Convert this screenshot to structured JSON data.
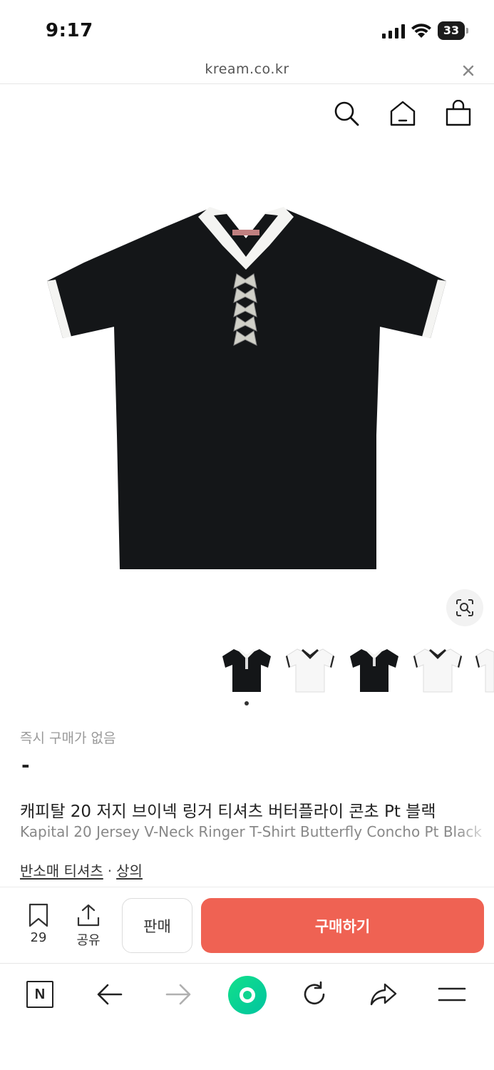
{
  "status_bar": {
    "time": "9:17",
    "battery": "33"
  },
  "url_bar": {
    "domain": "kream.co.kr"
  },
  "header": {
    "icons": [
      "search-icon",
      "home-icon",
      "shopping-bag-icon"
    ]
  },
  "product": {
    "price_label": "즉시 구매가 없음",
    "price_value": "-",
    "title_ko": "캐피탈 20 저지 브이넥 링거 티셔츠 버터플라이 콘초 Pt 블랙",
    "title_en": "Kapital 20 Jersey V-Neck Ringer T-Shirt Butterfly Concho Pt Black",
    "category_primary": "반소매 티셔츠",
    "category_separator": "·",
    "category_secondary": "상의"
  },
  "thumbnails": [
    {
      "variant": "black-white-trim",
      "selected": true
    },
    {
      "variant": "white-black-trim",
      "selected": false
    },
    {
      "variant": "black-white-trim",
      "selected": false
    },
    {
      "variant": "white-black-trim",
      "selected": false
    },
    {
      "variant": "white-partial",
      "selected": false
    }
  ],
  "actions": {
    "wish_count": "29",
    "share_label": "공유",
    "sell_label": "판매",
    "buy_label": "구매하기"
  },
  "browser_toolbar": {
    "naver_label": "N",
    "icons": [
      "naver-icon",
      "back-arrow-icon",
      "forward-arrow-icon",
      "green-dot-button",
      "refresh-icon",
      "share-arrow-icon",
      "menu-icon"
    ]
  },
  "colors": {
    "buy_button": "#ef6253",
    "green_ball": "#12e08a",
    "shirt_black": "#141618",
    "trim_white": "#f4f4f2"
  }
}
